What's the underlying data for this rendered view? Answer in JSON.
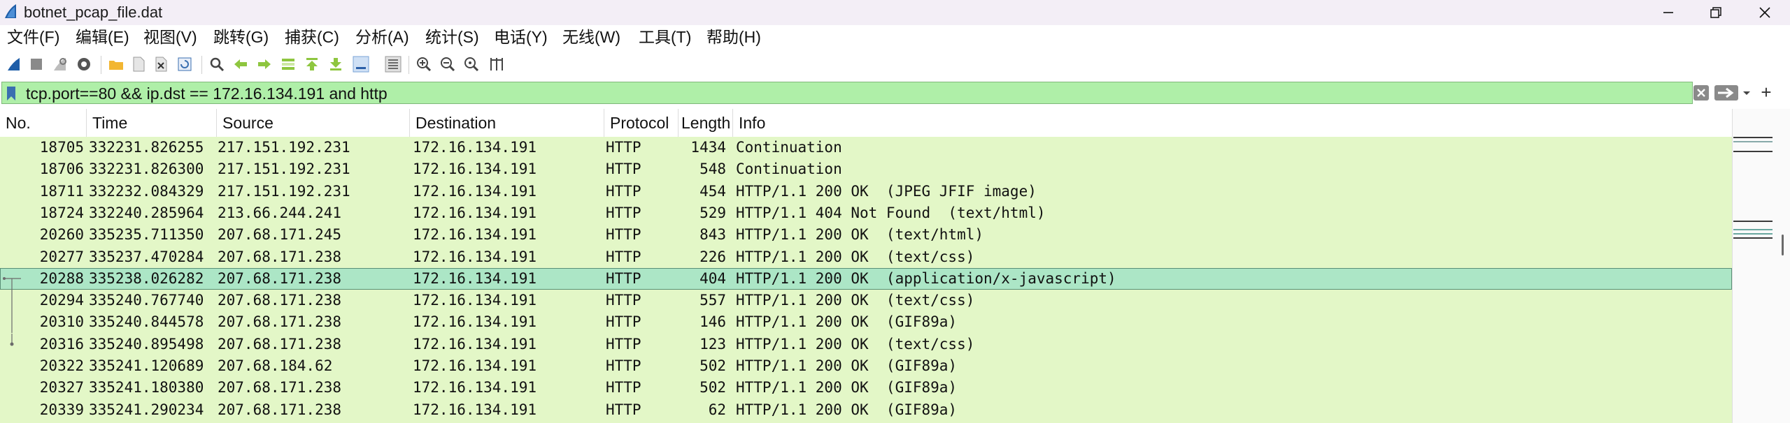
{
  "window": {
    "title": "botnet_pcap_file.dat",
    "minimize": "—",
    "maximize": "❐",
    "close": "✕"
  },
  "menu": [
    "文件(F)",
    "编辑(E)",
    "视图(V)",
    "跳转(G)",
    "捕获(C)",
    "分析(A)",
    "统计(S)",
    "电话(Y)",
    "无线(W)",
    "工具(T)",
    "帮助(H)"
  ],
  "toolbar_icons": [
    "shark-fin-start-icon",
    "stop-square-icon",
    "restart-fin-icon",
    "capture-options-gear-icon",
    "open-folder-icon",
    "save-file-icon",
    "close-file-icon",
    "reload-icon",
    "find-packet-icon",
    "go-back-icon",
    "go-forward-icon",
    "go-to-packet-icon",
    "go-first-icon",
    "go-last-icon",
    "autoscroll-icon",
    "colorize-icon",
    "zoom-in-icon",
    "zoom-out-icon",
    "zoom-normal-icon",
    "resize-columns-icon"
  ],
  "filter": {
    "text": "tcp.port==80 && ip.dst == 172.16.134.191 and http",
    "plus": "+"
  },
  "columns": [
    "No.",
    "Time",
    "Source",
    "Destination",
    "Protocol",
    "Length",
    "Info"
  ],
  "packets": [
    {
      "no": "18705",
      "time": "332231.826255",
      "src": "217.151.192.231",
      "dst": "172.16.134.191",
      "proto": "HTTP",
      "len": "1434",
      "info": "Continuation"
    },
    {
      "no": "18706",
      "time": "332231.826300",
      "src": "217.151.192.231",
      "dst": "172.16.134.191",
      "proto": "HTTP",
      "len": "548",
      "info": "Continuation"
    },
    {
      "no": "18711",
      "time": "332232.084329",
      "src": "217.151.192.231",
      "dst": "172.16.134.191",
      "proto": "HTTP",
      "len": "454",
      "info": "HTTP/1.1 200 OK  (JPEG JFIF image)"
    },
    {
      "no": "18724",
      "time": "332240.285964",
      "src": "213.66.244.241",
      "dst": "172.16.134.191",
      "proto": "HTTP",
      "len": "529",
      "info": "HTTP/1.1 404 Not Found  (text/html)"
    },
    {
      "no": "20260",
      "time": "335235.711350",
      "src": "207.68.171.245",
      "dst": "172.16.134.191",
      "proto": "HTTP",
      "len": "843",
      "info": "HTTP/1.1 200 OK  (text/html)"
    },
    {
      "no": "20277",
      "time": "335237.470284",
      "src": "207.68.171.238",
      "dst": "172.16.134.191",
      "proto": "HTTP",
      "len": "226",
      "info": "HTTP/1.1 200 OK  (text/css)"
    },
    {
      "no": "20288",
      "time": "335238.026282",
      "src": "207.68.171.238",
      "dst": "172.16.134.191",
      "proto": "HTTP",
      "len": "404",
      "info": "HTTP/1.1 200 OK  (application/x-javascript)",
      "selected": true
    },
    {
      "no": "20294",
      "time": "335240.767740",
      "src": "207.68.171.238",
      "dst": "172.16.134.191",
      "proto": "HTTP",
      "len": "557",
      "info": "HTTP/1.1 200 OK  (text/css)"
    },
    {
      "no": "20310",
      "time": "335240.844578",
      "src": "207.68.171.238",
      "dst": "172.16.134.191",
      "proto": "HTTP",
      "len": "146",
      "info": "HTTP/1.1 200 OK  (GIF89a)"
    },
    {
      "no": "20316",
      "time": "335240.895498",
      "src": "207.68.171.238",
      "dst": "172.16.134.191",
      "proto": "HTTP",
      "len": "123",
      "info": "HTTP/1.1 200 OK  (text/css)"
    },
    {
      "no": "20322",
      "time": "335241.120689",
      "src": "207.68.184.62",
      "dst": "172.16.134.191",
      "proto": "HTTP",
      "len": "502",
      "info": "HTTP/1.1 200 OK  (GIF89a)"
    },
    {
      "no": "20327",
      "time": "335241.180380",
      "src": "207.68.171.238",
      "dst": "172.16.134.191",
      "proto": "HTTP",
      "len": "502",
      "info": "HTTP/1.1 200 OK  (GIF89a)"
    },
    {
      "no": "20339",
      "time": "335241.290234",
      "src": "207.68.171.238",
      "dst": "172.16.134.191",
      "proto": "HTTP",
      "len": "62",
      "info": "HTTP/1.1 200 OK  (GIF89a)"
    }
  ],
  "colors": {
    "row_bg": "#e3f7c7",
    "selected_bg": "#ace6c6",
    "filter_bg": "#afefa8"
  }
}
